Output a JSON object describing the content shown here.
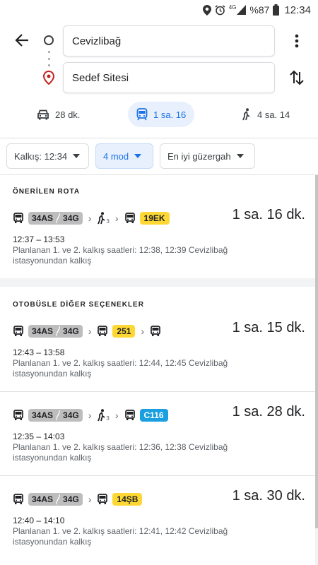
{
  "status_bar": {
    "signal_label": "4G",
    "battery": "%87",
    "time": "12:34"
  },
  "search": {
    "origin": "Cevizlibağ",
    "destination": "Sedef Sitesi"
  },
  "modes": {
    "car": "28 dk.",
    "transit": "1 sa. 16",
    "walk": "4 sa. 14"
  },
  "filters": {
    "departure": "Kalkış: 12:34",
    "mode": "4 mod",
    "best": "En iyi güzergah"
  },
  "recommended": {
    "title": "ÖNERİLEN ROTA",
    "route": {
      "line1": "34AS",
      "line2": "34G",
      "walk_minutes": "3",
      "line3": "19EK",
      "duration": "1 sa. 16 dk.",
      "times": "12:37 – 13:53",
      "detail": "Planlanan 1. ve 2. kalkış saatleri: 12:38, 12:39 Cevizlibağ istasyonundan kalkış"
    }
  },
  "other": {
    "title": "OTOBÜSLE DİĞER SEÇENEKLER",
    "routes": [
      {
        "line1": "34AS",
        "line2": "34G",
        "line3": "251",
        "duration": "1 sa. 15 dk.",
        "times": "12:43 – 13:58",
        "detail": "Planlanan 1. ve 2. kalkış saatleri: 12:44, 12:45 Cevizlibağ istasyonundan kalkış"
      },
      {
        "line1": "34AS",
        "line2": "34G",
        "walk_minutes": "3",
        "line3": "C116",
        "duration": "1 sa. 28 dk.",
        "times": "12:35 – 14:03",
        "detail": "Planlanan 1. ve 2. kalkış saatleri: 12:36, 12:38 Cevizlibağ istasyonundan kalkış"
      },
      {
        "line1": "34AS",
        "line2": "34G",
        "line3": "14ŞB",
        "duration": "1 sa. 30 dk.",
        "times": "12:40 – 14:10",
        "detail": "Planlanan 1. ve 2. kalkış saatleri: 12:41, 12:42 Cevizlibağ istasyonundan kalkış"
      }
    ]
  },
  "colors": {
    "accent": "#1a73e8",
    "accent_bg": "#e8f0fe",
    "badge_yellow": "#fdd835",
    "badge_blue": "#1a9fe0",
    "badge_grey": "#bdbdbd",
    "pin_red": "#c5221f"
  },
  "icons": [
    "location-icon",
    "alarm-icon",
    "signal-icon",
    "battery-icon",
    "back-arrow-icon",
    "origin-circle-icon",
    "destination-pin-icon",
    "more-vert-icon",
    "swap-icon",
    "car-icon",
    "transit-icon",
    "walk-icon",
    "bus-icon",
    "chevron-right-icon",
    "dropdown-caret-icon"
  ]
}
